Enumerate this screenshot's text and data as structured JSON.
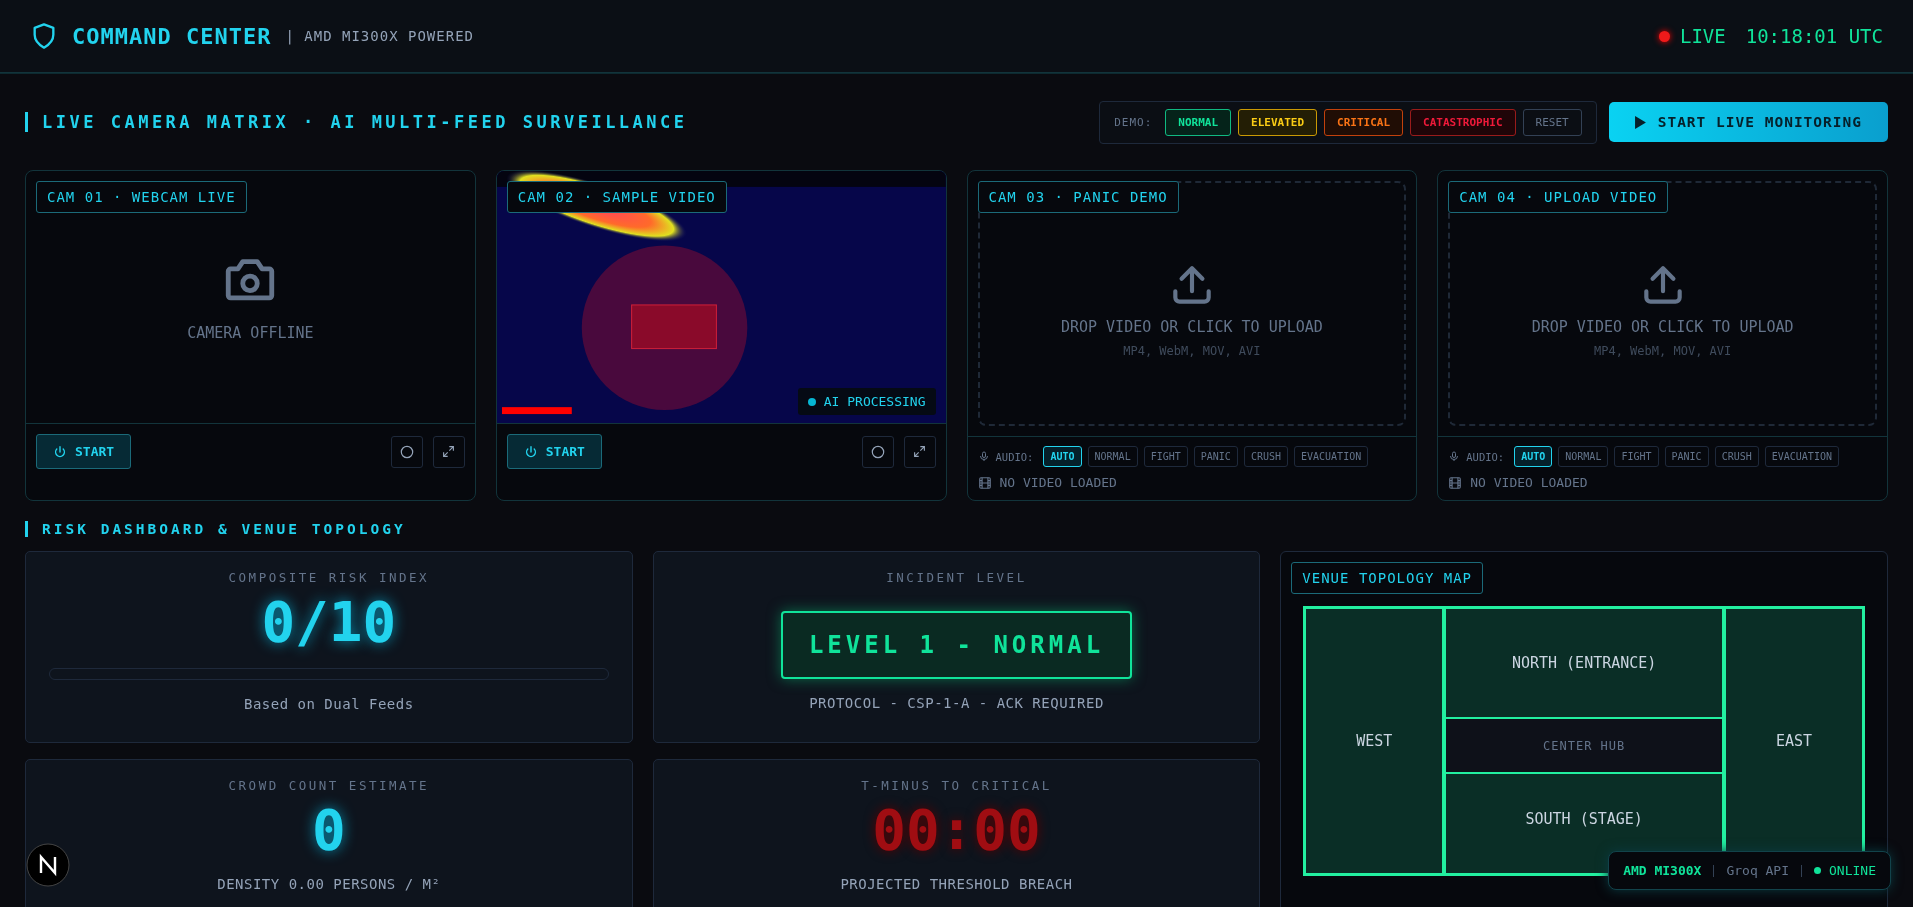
{
  "header": {
    "title": "COMMAND CENTER",
    "subtitle": "| AMD MI300X POWERED",
    "live_label": "LIVE",
    "time": "10:18:01 UTC"
  },
  "camera_section": {
    "title": "LIVE CAMERA MATRIX · AI MULTI-FEED SURVEILLANCE",
    "demo_label": "DEMO:",
    "demo_buttons": [
      {
        "label": "NORMAL",
        "kind": "normal"
      },
      {
        "label": "ELEVATED",
        "kind": "elevated"
      },
      {
        "label": "CRITICAL",
        "kind": "critical"
      },
      {
        "label": "CATASTROPHIC",
        "kind": "catastrophic"
      },
      {
        "label": "RESET",
        "kind": "reset"
      }
    ],
    "start_button": "START LIVE MONITORING"
  },
  "cameras": [
    {
      "kind": "webcam",
      "label": "CAM 01 · WEBCAM LIVE",
      "status": "CAMERA OFFLINE",
      "start_button": "START"
    },
    {
      "kind": "video",
      "label": "CAM 02 · SAMPLE VIDEO",
      "badge": "AI PROCESSING",
      "start_button": "START"
    },
    {
      "kind": "upload",
      "label": "CAM 03 · PANIC DEMO",
      "drop_text": "DROP VIDEO OR CLICK TO UPLOAD",
      "formats": "MP4, WebM, MOV, AVI",
      "audio_label": "AUDIO:",
      "audio_modes": [
        {
          "label": "AUTO",
          "selected": true
        },
        {
          "label": "NORMAL",
          "selected": false
        },
        {
          "label": "FIGHT",
          "selected": false
        },
        {
          "label": "PANIC",
          "selected": false
        },
        {
          "label": "CRUSH",
          "selected": false
        },
        {
          "label": "EVACUATION",
          "selected": false
        }
      ],
      "status": "NO VIDEO LOADED"
    },
    {
      "kind": "upload",
      "label": "CAM 04 · UPLOAD VIDEO",
      "drop_text": "DROP VIDEO OR CLICK TO UPLOAD",
      "formats": "MP4, WebM, MOV, AVI",
      "audio_label": "AUDIO:",
      "audio_modes": [
        {
          "label": "AUTO",
          "selected": true
        },
        {
          "label": "NORMAL",
          "selected": false
        },
        {
          "label": "FIGHT",
          "selected": false
        },
        {
          "label": "PANIC",
          "selected": false
        },
        {
          "label": "CRUSH",
          "selected": false
        },
        {
          "label": "EVACUATION",
          "selected": false
        }
      ],
      "status": "NO VIDEO LOADED"
    }
  ],
  "dashboard": {
    "title": "RISK DASHBOARD & VENUE TOPOLOGY",
    "cards": [
      {
        "kind": "risk",
        "title": "COMPOSITE RISK INDEX",
        "value": "0/10",
        "level": 0,
        "caption": "Based on Dual Feeds"
      },
      {
        "kind": "incident",
        "title": "INCIDENT LEVEL",
        "value": "LEVEL 1 - NORMAL",
        "caption": "PROTOCOL - CSP-1-A - ACK REQUIRED"
      },
      {
        "kind": "crowd",
        "title": "CROWD COUNT ESTIMATE",
        "value": "0",
        "caption": "DENSITY 0.00 PERSONS / M²"
      },
      {
        "kind": "timer",
        "title": "T-MINUS TO CRITICAL",
        "value": "00:00",
        "caption": "PROJECTED THRESHOLD BREACH"
      }
    ],
    "topology": {
      "title": "VENUE TOPOLOGY MAP",
      "zones": [
        {
          "kind": "west",
          "label": "WEST"
        },
        {
          "kind": "north",
          "label": "NORTH (ENTRANCE)"
        },
        {
          "kind": "center",
          "label": "CENTER HUB"
        },
        {
          "kind": "south",
          "label": "SOUTH (STAGE)"
        },
        {
          "kind": "east",
          "label": "EAST"
        }
      ]
    }
  },
  "status_pill": {
    "processor": "AMD MI300X",
    "api": "Groq API",
    "status": "ONLINE"
  }
}
